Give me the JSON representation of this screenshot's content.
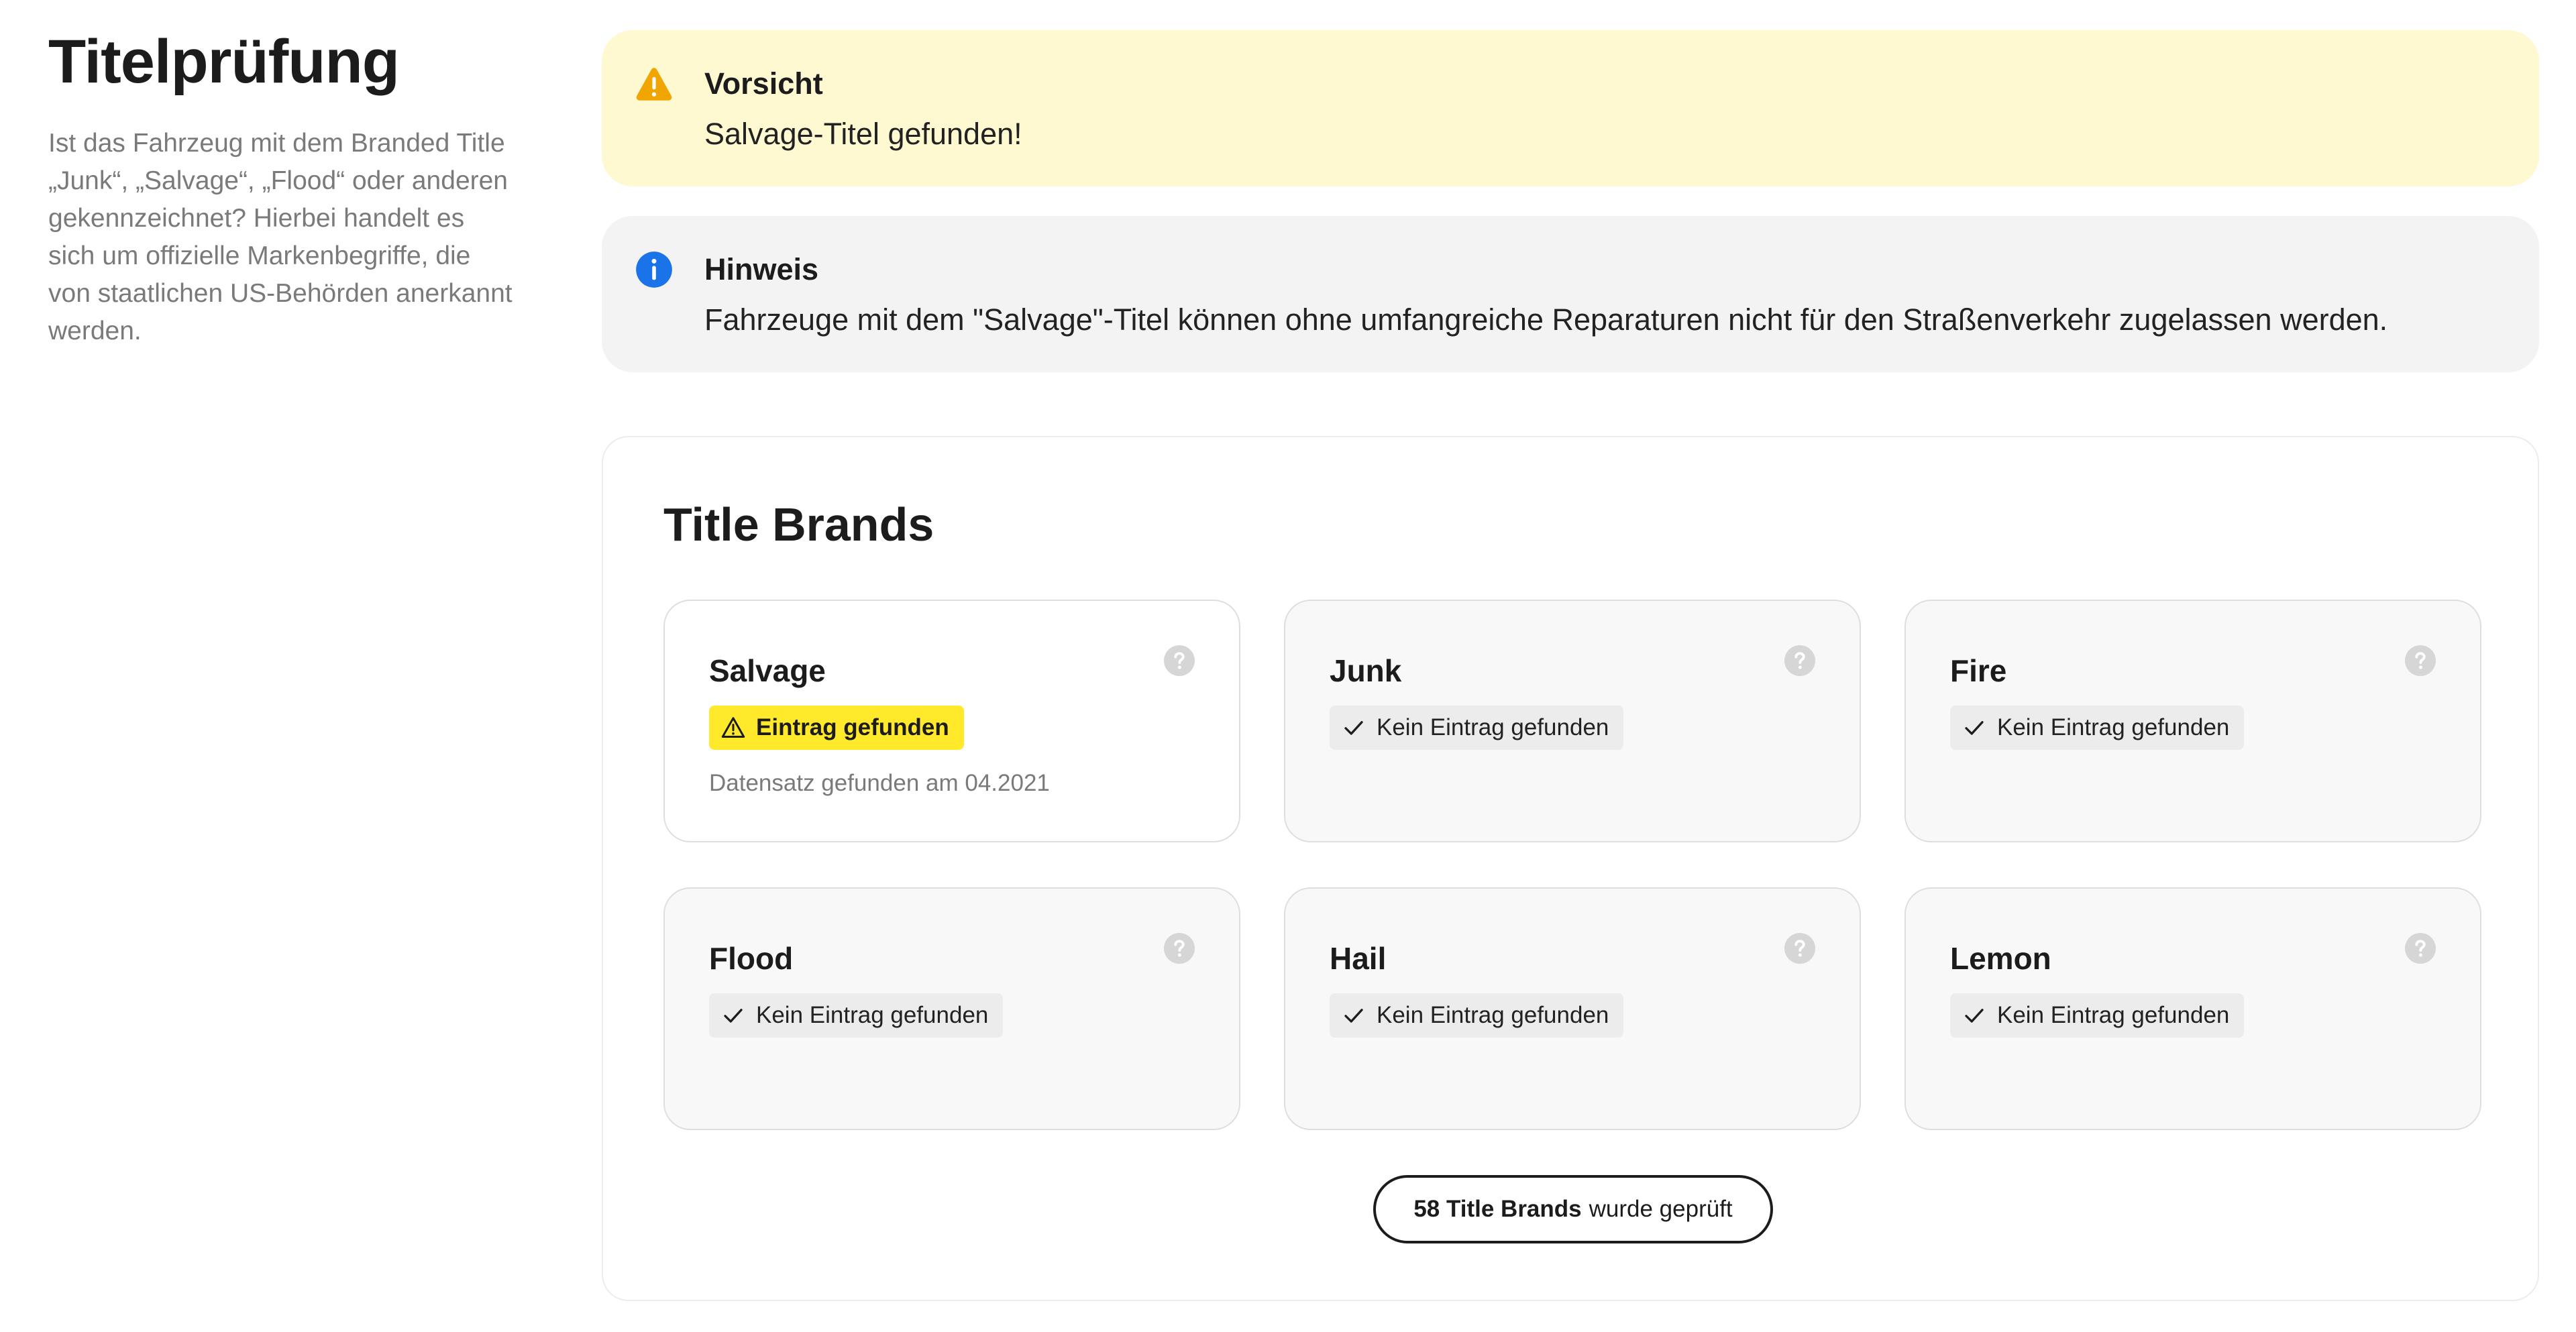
{
  "page": {
    "title": "Titelprüfung",
    "description": "Ist das Fahrzeug mit dem Branded Title „Junk“, „Salvage“, „Flood“ oder anderen gekennzeichnet? Hierbei handelt es sich um offizielle Markenbegriffe, die von staatlichen US-Behörden anerkannt werden."
  },
  "alerts": {
    "warning": {
      "icon": "warning-icon",
      "title": "Vorsicht",
      "text": "Salvage-Titel gefunden!",
      "color": "#fff9d2"
    },
    "info": {
      "icon": "info-icon",
      "title": "Hinweis",
      "text": "Fahrzeuge mit dem \"Salvage\"-Titel können ohne umfangreiche Reparaturen nicht für den Straßenverkehr zugelassen werden.",
      "color": "#f3f3f3"
    }
  },
  "title_brands": {
    "heading": "Title Brands",
    "cards": [
      {
        "name": "Salvage",
        "status": "found",
        "badge": "Eintrag gefunden",
        "meta": "Datensatz gefunden am 04.2021"
      },
      {
        "name": "Junk",
        "status": "none",
        "badge": "Kein Eintrag gefunden"
      },
      {
        "name": "Fire",
        "status": "none",
        "badge": "Kein Eintrag gefunden"
      },
      {
        "name": "Flood",
        "status": "none",
        "badge": "Kein Eintrag gefunden"
      },
      {
        "name": "Hail",
        "status": "none",
        "badge": "Kein Eintrag gefunden"
      },
      {
        "name": "Lemon",
        "status": "none",
        "badge": "Kein Eintrag gefunden"
      }
    ],
    "checked_count": "58 Title Brands",
    "checked_suffix": "wurde geprüft"
  },
  "colors": {
    "warning_icon": "#f0a500",
    "info_icon": "#1a73e8",
    "found_badge": "#ffe92a",
    "none_badge": "#ececec",
    "help_icon": "#d6d6d6"
  }
}
